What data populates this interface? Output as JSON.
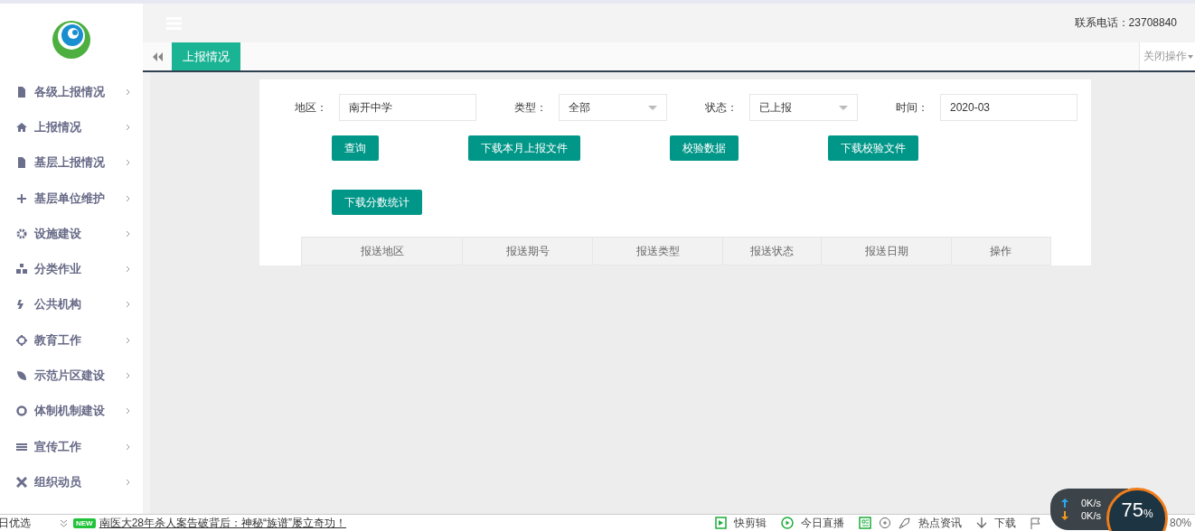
{
  "sidebar": {
    "items": [
      {
        "label": "各级上报情况"
      },
      {
        "label": "上报情况"
      },
      {
        "label": "基层上报情况"
      },
      {
        "label": "基层单位维护"
      },
      {
        "label": "设施建设"
      },
      {
        "label": "分类作业"
      },
      {
        "label": "公共机构"
      },
      {
        "label": "教育工作"
      },
      {
        "label": "示范片区建设"
      },
      {
        "label": "体制机制建设"
      },
      {
        "label": "宣传工作"
      },
      {
        "label": "组织动员"
      }
    ]
  },
  "header": {
    "phone": "联系电话：23708840"
  },
  "tabs": [
    {
      "label": "上报情况",
      "selected": true
    }
  ],
  "close_menu": "关闭操作",
  "filters": [
    {
      "label": "地区：",
      "kind": "text",
      "value": "南开中学"
    },
    {
      "label": "类型：",
      "kind": "select",
      "value": "全部"
    },
    {
      "label": "状态：",
      "kind": "select",
      "value": "已上报"
    },
    {
      "label": "时间：",
      "kind": "text",
      "value": "2020-03"
    }
  ],
  "button_rows": [
    [
      "查询",
      "下载本月上报文件",
      "校验数据",
      "下载校验文件"
    ],
    [
      "下载分数统计"
    ]
  ],
  "table": {
    "columns": [
      "报送地区",
      "报送期号",
      "报送类型",
      "报送状态",
      "报送日期",
      "操作"
    ]
  },
  "status_bar": {
    "left": "日优选",
    "badge": "NEW",
    "headline": "南医大28年杀人案告破背后：神秘“族谱”屡立奇功！",
    "items": [
      "快剪辑",
      "今日直播",
      "热点资讯",
      "下载"
    ],
    "zoom": "80%"
  },
  "speed_widget": {
    "upload": "0K/s",
    "download": "0K/s",
    "percent": "75",
    "unit": "%"
  }
}
